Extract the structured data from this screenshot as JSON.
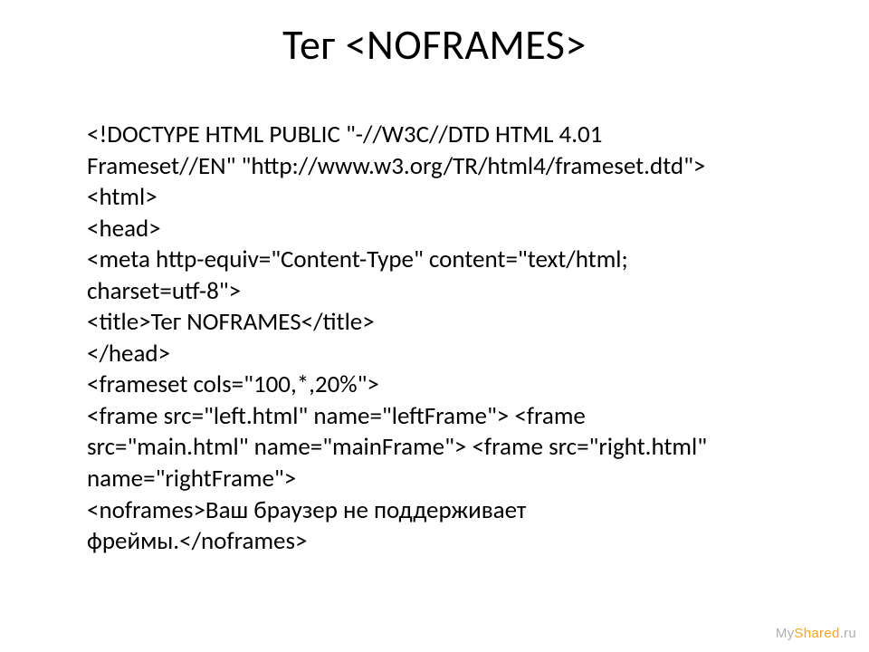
{
  "title": "Тег <NOFRAMES>",
  "code_lines": [
    "<!DOCTYPE HTML PUBLIC \"-//W3C//DTD HTML 4.01",
    "Frameset//EN\" \"http://www.w3.org/TR/html4/frameset.dtd\">",
    "<html>",
    "<head>",
    "<meta http-equiv=\"Content-Type\" content=\"text/html;",
    "charset=utf-8\">",
    "<title>Тег NOFRAMES</title>",
    "</head>",
    "<frameset cols=\"100,*,20%\">",
    "<frame src=\"left.html\" name=\"leftFrame\"> <frame",
    "src=\"main.html\" name=\"mainFrame\"> <frame src=\"right.html\"",
    "name=\"rightFrame\">",
    "<noframes>Ваш браузер не поддерживает",
    "фреймы.</noframes>"
  ],
  "watermark": {
    "grey": "My",
    "orange": "Shared",
    "grey2": ".ru"
  }
}
